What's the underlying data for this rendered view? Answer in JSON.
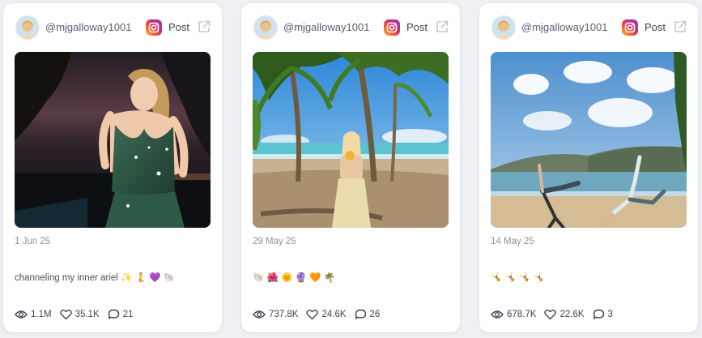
{
  "colors": {
    "page_background": "#eef0f4",
    "card_background": "#ffffff",
    "instagram_gradient": [
      "#f9c545",
      "#f2622e",
      "#d42b7a",
      "#8b3ac7"
    ]
  },
  "icons": {
    "platform": "instagram-icon",
    "external": "external-link-icon",
    "views": "eye-icon",
    "likes": "heart-icon",
    "comments": "comment-icon"
  },
  "posts": [
    {
      "handle": "@mjgalloway1001",
      "type_label": "Post",
      "date": "1 Jun 25",
      "caption": "channeling my inner ariel ✨ 🧜 💜 🐚",
      "views": "1.1M",
      "likes": "35.1K",
      "comments": "21"
    },
    {
      "handle": "@mjgalloway1001",
      "type_label": "Post",
      "date": "29 May 25",
      "caption": "🐚 🌺 🌞 🔮 🧡 🌴",
      "views": "737.8K",
      "likes": "24.6K",
      "comments": "26"
    },
    {
      "handle": "@mjgalloway1001",
      "type_label": "Post",
      "date": "14 May 25",
      "caption": "🤸 🤸 🤸 🤸",
      "views": "678.7K",
      "likes": "22.6K",
      "comments": "3"
    }
  ]
}
